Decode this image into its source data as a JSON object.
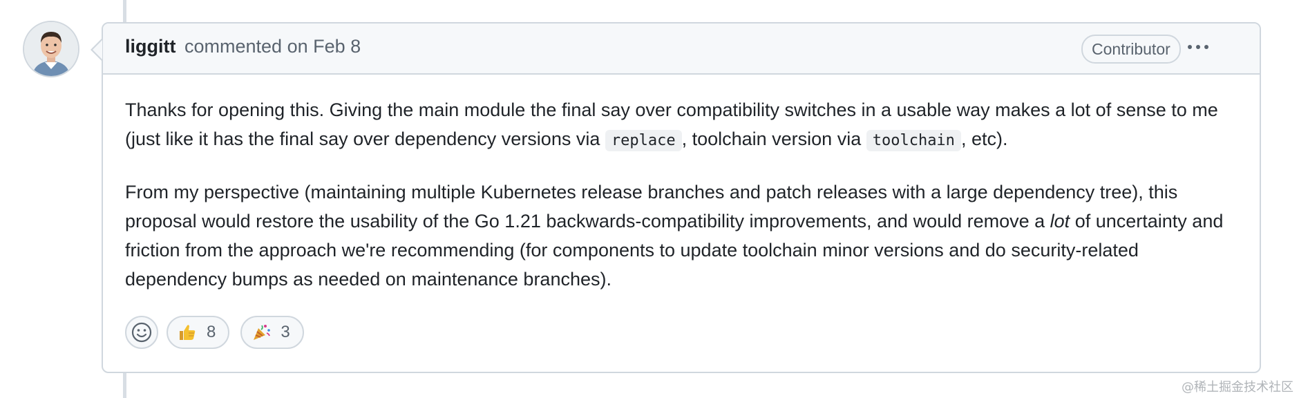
{
  "comment": {
    "author": "liggitt",
    "meta": "commented on Feb 8",
    "role_badge": "Contributor",
    "more_options_icon": "kebab-horizontal-icon",
    "body": {
      "p1": {
        "t1": "Thanks for opening this. Giving the main module the final say over compatibility switches in a usable way makes a lot of sense to me (just like it has the final say over dependency versions via ",
        "code1": "replace",
        "t2": ", toolchain version via ",
        "code2": "toolchain",
        "t3": ", etc)."
      },
      "p2": {
        "t1": "From my perspective (maintaining multiple Kubernetes release branches and patch releases with a large dependency tree), this proposal would restore the usability of the Go 1.21 backwards-compatibility improvements, and would remove a ",
        "em": "lot",
        "t2": " of uncertainty and friction from the approach we're recommending (for components to update toolchain minor versions and do security-related dependency bumps as needed on maintenance branches)."
      }
    },
    "reactions": [
      {
        "icon": "thumbs-up-icon",
        "count": "8"
      },
      {
        "icon": "party-popper-icon",
        "count": "3"
      }
    ],
    "add_reaction_icon": "smiley-icon"
  },
  "watermark": "@稀土掘金技术社区",
  "colors": {
    "border": "#d0d7de",
    "header_bg": "#f6f8fa",
    "text": "#1f2328",
    "muted": "#59636e"
  }
}
